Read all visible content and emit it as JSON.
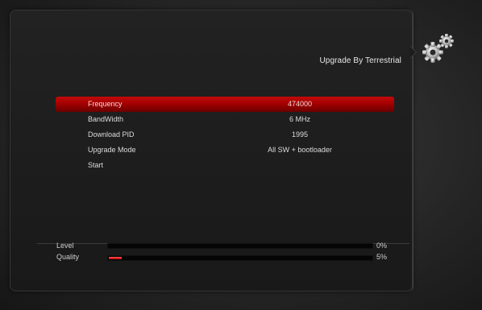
{
  "header": {
    "title": "Upgrade By Terrestrial",
    "icon": "gears-icon"
  },
  "menu": {
    "items": [
      {
        "label": "Frequency",
        "value": "474000"
      },
      {
        "label": "BandWidth",
        "value": "6 MHz"
      },
      {
        "label": "Download PID",
        "value": "1995"
      },
      {
        "label": "Upgrade Mode",
        "value": "All SW + bootloader"
      },
      {
        "label": "Start",
        "value": ""
      }
    ],
    "selected_index": 0
  },
  "signal": {
    "level": {
      "label": "Level",
      "percent_text": "0%",
      "fraction": 0.0
    },
    "quality": {
      "label": "Quality",
      "percent_text": "5%",
      "fraction": 0.05
    }
  },
  "colors": {
    "highlight": "#b00000",
    "meter_fill": "#e02020",
    "panel": "#1f1f1f"
  }
}
